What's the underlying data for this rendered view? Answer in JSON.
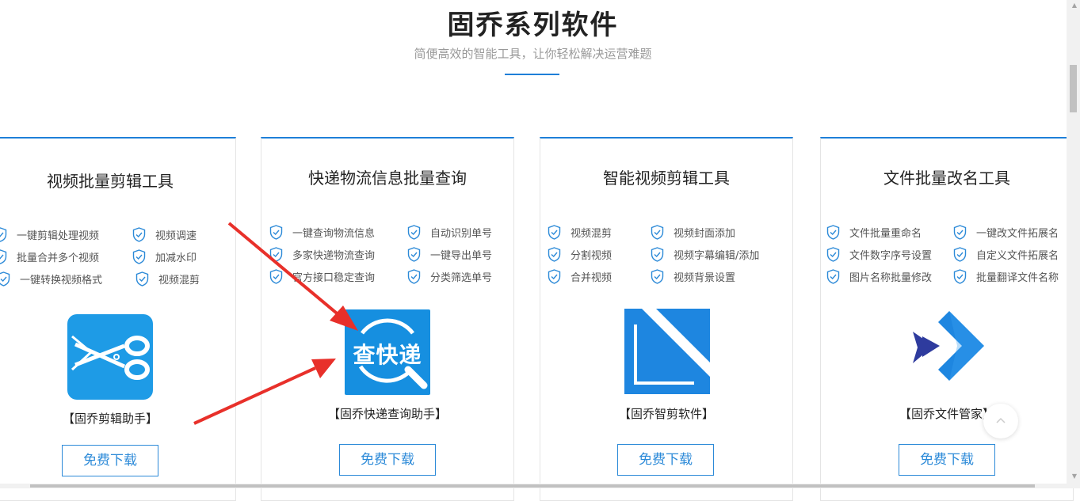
{
  "header": {
    "title": "固乔系列软件",
    "subtitle": "简便高效的智能工具，让你轻松解决运营难题"
  },
  "colors": {
    "accent": "#1e7fd8",
    "arrow": "#e8302a",
    "check": "#2c8ad8"
  },
  "cards": [
    {
      "title": "视频批量剪辑工具",
      "features": [
        "一键剪辑处理视频",
        "视频调速",
        "批量合并多个视频",
        "加减水印",
        "一键转换视频格式",
        "视频混剪"
      ],
      "logo_icon": "scissors-icon",
      "product_name": "【固乔剪辑助手】",
      "download_label": "免费下载"
    },
    {
      "title": "快递物流信息批量查询",
      "features": [
        "一键查询物流信息",
        "自动识别单号",
        "多家快递物流查询",
        "一键导出单号",
        "官方接口稳定查询",
        "分类筛选单号"
      ],
      "logo_icon": "magnifier-icon",
      "logo_text": "查快递",
      "product_name": "【固乔快递查询助手】",
      "download_label": "免费下载"
    },
    {
      "title": "智能视频剪辑工具",
      "features": [
        "视频混剪",
        "视频封面添加",
        "分割视频",
        "视频字幕编辑/添加",
        "合并视频",
        "视频背景设置"
      ],
      "logo_icon": "crop-frame-icon",
      "product_name": "【固乔智剪软件】",
      "download_label": "免费下载"
    },
    {
      "title": "文件批量改名工具",
      "features": [
        "文件批量重命名",
        "一键改文件拓展名",
        "文件数字序号设置",
        "自定义文件拓展名",
        "图片名称批量修改",
        "批量翻译文件名称"
      ],
      "logo_icon": "chevron-logo-icon",
      "product_name": "【固乔文件管家】",
      "download_label": "免费下载"
    }
  ]
}
